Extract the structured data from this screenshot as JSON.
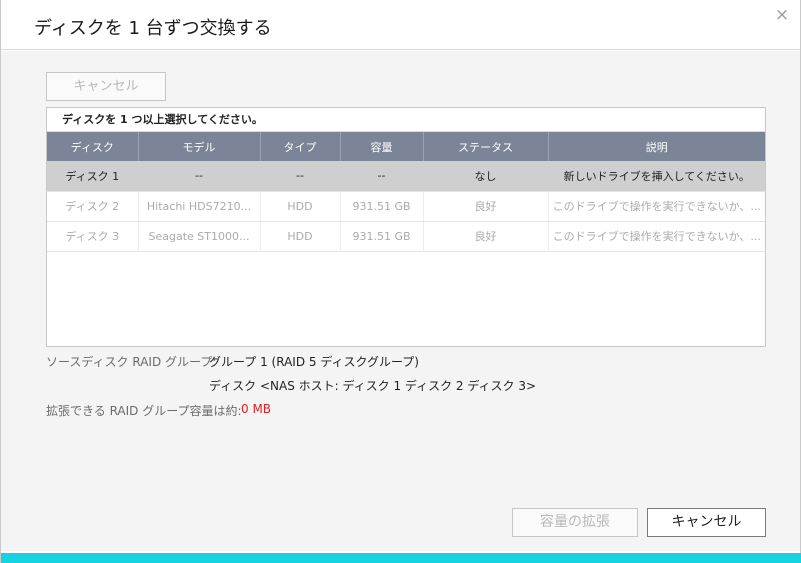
{
  "dialog": {
    "title": "ディスクを 1 台ずつ交換する",
    "close_glyph": "×"
  },
  "toolbar": {
    "cancel_label": "キャンセル"
  },
  "panel": {
    "heading": "ディスクを 1 つ以上選択してください。"
  },
  "table": {
    "columns": [
      "ディスク",
      "モデル",
      "タイプ",
      "容量",
      "ステータス",
      "説明"
    ],
    "rows": [
      {
        "disk": "ディスク 1",
        "model": "--",
        "type": "--",
        "capacity": "--",
        "status": "なし",
        "desc": "新しいドライブを挿入してください。",
        "selected": true
      },
      {
        "disk": "ディスク 2",
        "model": "Hitachi HDS7210...",
        "type": "HDD",
        "capacity": "931.51 GB",
        "status": "良好",
        "desc": "このドライブで操作を実行できないか、...",
        "selected": false
      },
      {
        "disk": "ディスク 3",
        "model": "Seagate ST1000...",
        "type": "HDD",
        "capacity": "931.51 GB",
        "status": "良好",
        "desc": "このドライブで操作を実行できないか、...",
        "selected": false
      }
    ]
  },
  "info": {
    "source_label": "ソースディスク RAID グループ:",
    "source_value": "グループ 1 (RAID 5 ディスクグループ)",
    "disks_value": "ディスク <NAS ホスト: ディスク 1 ディスク 2 ディスク 3>",
    "expandable_label": "拡張できる RAID グループ容量は約:",
    "expandable_value": "0 MB"
  },
  "footer": {
    "expand_label": "容量の拡張",
    "cancel_label": "キャンセル"
  },
  "colors": {
    "accent": "#16d3e2",
    "header": "#7b8597",
    "warning": "#e02020"
  }
}
